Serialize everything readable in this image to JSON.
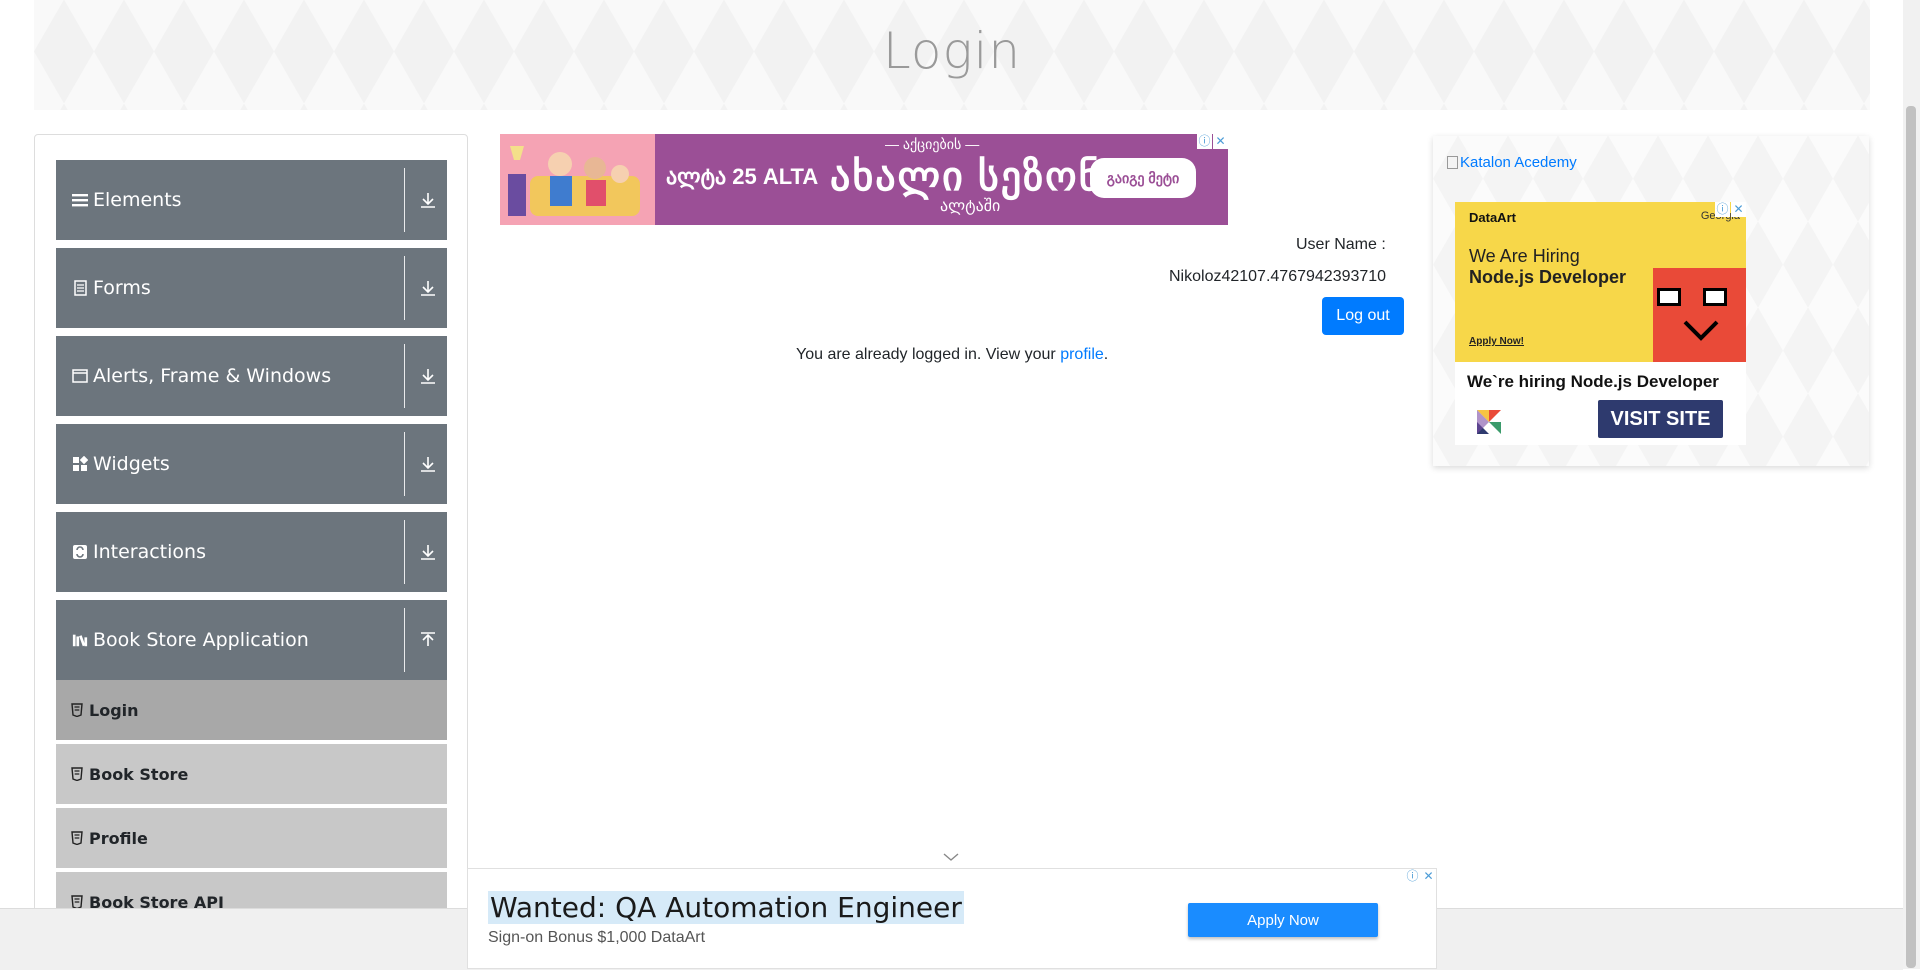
{
  "header": {
    "title": "Login"
  },
  "sidebar": {
    "groups": [
      {
        "label": "Elements",
        "icon": "list-icon"
      },
      {
        "label": "Forms",
        "icon": "form-icon"
      },
      {
        "label": "Alerts, Frame & Windows",
        "icon": "window-icon"
      },
      {
        "label": "Widgets",
        "icon": "widgets-icon"
      },
      {
        "label": "Interactions",
        "icon": "interactions-icon"
      },
      {
        "label": "Book Store Application",
        "icon": "books-icon",
        "expanded": true
      }
    ],
    "book_store_items": [
      {
        "label": "Login",
        "active": true
      },
      {
        "label": "Book Store"
      },
      {
        "label": "Profile"
      },
      {
        "label": "Book Store API"
      }
    ]
  },
  "top_ad": {
    "alta_text": "ალტა 25 ALTA",
    "small_text": "— აქციების —",
    "main_text": "ახალი სეზონი",
    "sub_text": "ალტაში",
    "button_label": "გაიგე მეტი"
  },
  "account": {
    "username_label": "User Name :",
    "username_value": "Nikoloz42107.4767942393710",
    "logout_label": "Log out",
    "message_prefix": "You are already logged in. View your ",
    "message_link": "profile",
    "message_suffix": "."
  },
  "right_ad": {
    "katalon_alt": "Katalon Acedemy",
    "brand": "DataArt",
    "country": "Georgia",
    "hiring_line1": "We Are Hiring",
    "hiring_line2": "Node.js Developer",
    "apply_small": "Apply Now!",
    "bottom_text": "We`re hiring Node.js Developer",
    "visit_label": "VISIT SITE"
  },
  "bottom_ad": {
    "headline": "Wanted: QA Automation Engineer",
    "sub": "Sign-on Bonus $1,000 DataArt",
    "apply_label": "Apply Now"
  },
  "colors": {
    "accent": "#007bff",
    "sidebar_header": "#6c757d",
    "sub_item": "#c8c8c8",
    "sub_item_active": "#a8a8a8"
  }
}
